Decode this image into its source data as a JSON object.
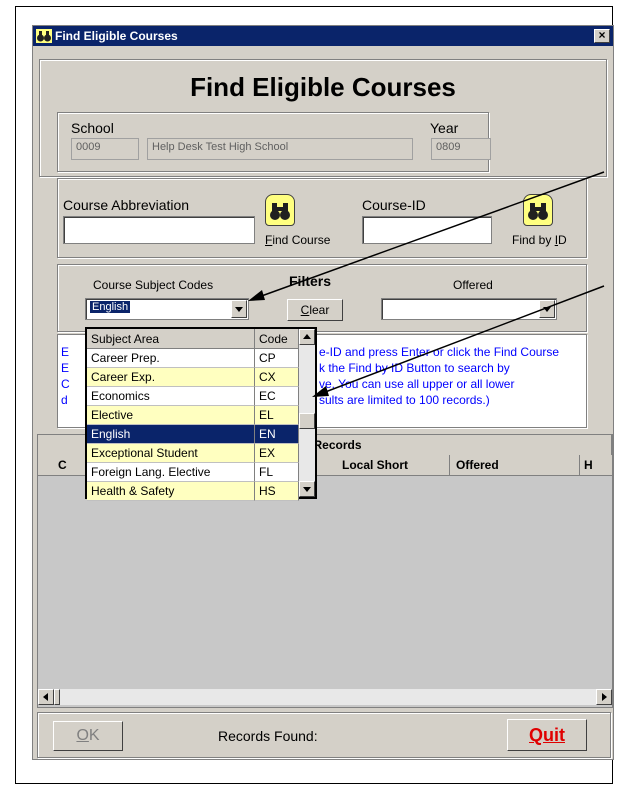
{
  "window": {
    "title": "Find Eligible Courses",
    "close_glyph": "×"
  },
  "header": {
    "title": "Find Eligible Courses"
  },
  "school": {
    "label": "School",
    "code": "0009",
    "name": "Help Desk Test High School"
  },
  "year": {
    "label": "Year",
    "value": "0809"
  },
  "course_abbreviation": {
    "label": "Course Abbreviation",
    "value": ""
  },
  "find_course": {
    "label": "Find Course",
    "accesskey": "F",
    "label_rest": "ind Course"
  },
  "course_id": {
    "label": "Course-ID",
    "value": ""
  },
  "find_by_id": {
    "label_pre": "Find by ",
    "accesskey": "I",
    "label_rest": "D"
  },
  "filters": {
    "title": "Filters",
    "subject_codes_label": "Course Subject Codes",
    "subject_selected": "English",
    "clear_accesskey": "C",
    "clear_rest": "lear",
    "offered_label": "Offered",
    "offered_value": ""
  },
  "instructions": {
    "lines": [
      "E",
      "E",
      "C",
      "d"
    ],
    "line1_right": "e-ID and press Enter or click the Find Course",
    "line2_right": "k the Find by ID Button to search by",
    "line3_right": "ve. You can use all upper or all lower",
    "line4_right": "sults are limited to 100 records.)"
  },
  "dropdown": {
    "col_subject": "Subject Area",
    "col_code": "Code",
    "rows": [
      {
        "subject": "Career Prep.",
        "code": "CP",
        "style": "white"
      },
      {
        "subject": "Career Exp.",
        "code": "CX",
        "style": "yellow"
      },
      {
        "subject": "Economics",
        "code": "EC",
        "style": "white"
      },
      {
        "subject": "Elective",
        "code": "EL",
        "style": "yellow"
      },
      {
        "subject": "English",
        "code": "EN",
        "style": "selected"
      },
      {
        "subject": "Exceptional Student",
        "code": "EX",
        "style": "yellow"
      },
      {
        "subject": "Foreign Lang. Elective",
        "code": "FL",
        "style": "white"
      },
      {
        "subject": "Health & Safety",
        "code": "HS",
        "style": "yellow"
      }
    ]
  },
  "records_grid": {
    "group_header": "Records",
    "col_c": "C",
    "col_local_short": "Local Short",
    "col_offered": "Offered",
    "col_h": "H"
  },
  "footer": {
    "ok_accesskey": "O",
    "ok_rest": "K",
    "records_found_label": "Records Found:",
    "quit_label": "Quit"
  },
  "colors": {
    "title_bar": "#0a246a",
    "row_yellow": "#ffffc0",
    "row_selected": "#0a246a",
    "instruction_text": "#0000ff",
    "quit_text": "#e00000"
  }
}
